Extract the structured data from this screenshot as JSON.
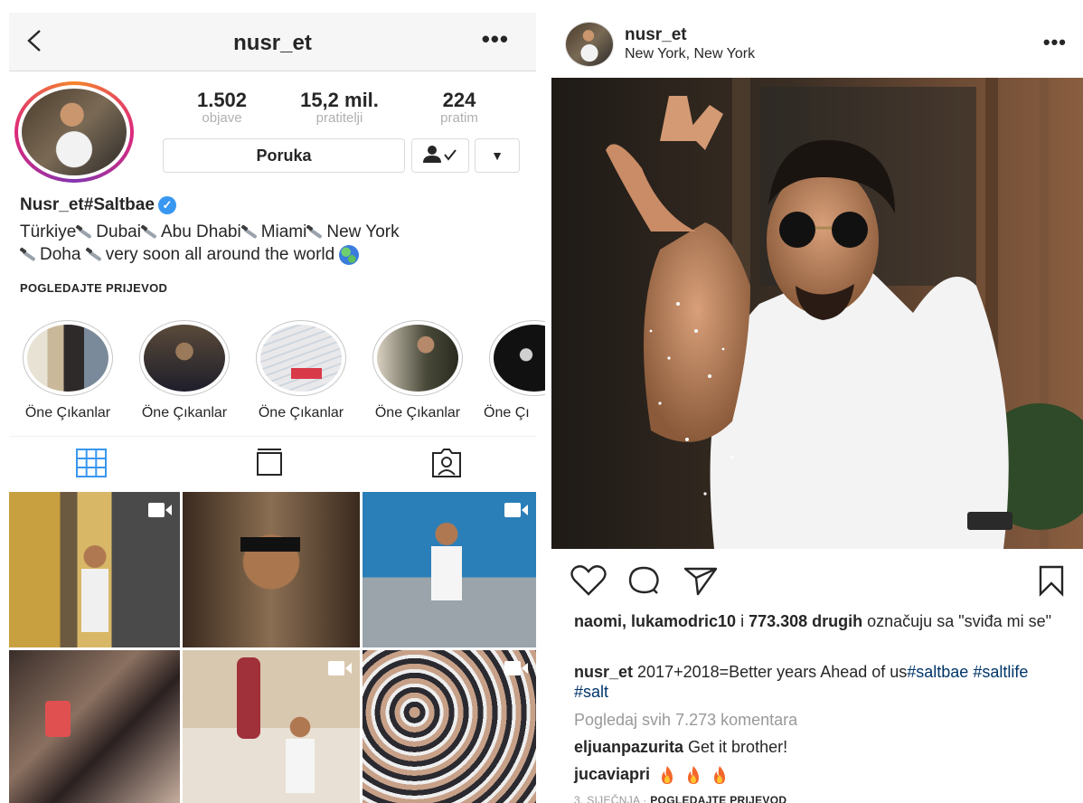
{
  "profile": {
    "header_username": "nusr_et",
    "stats": [
      {
        "value": "1.502",
        "label": "objave"
      },
      {
        "value": "15,2 mil.",
        "label": "pratitelji"
      },
      {
        "value": "224",
        "label": "pratim"
      }
    ],
    "message_button": "Poruka",
    "display_name": "Nusr_et#Saltbae",
    "bio": {
      "places": [
        "Türkiye",
        "Dubai",
        "Abu Dhabi",
        "Miami",
        "New York",
        "Doha"
      ],
      "tail": "very soon all around the world"
    },
    "translate": "POGLEDAJTE PRIJEVOD",
    "highlights": [
      "Öne Çıkanlar",
      "Öne Çıkanlar",
      "Öne Çıkanlar",
      "Öne Çıkanlar",
      "Öne Çı"
    ]
  },
  "post": {
    "username": "nusr_et",
    "location": "New York, New York",
    "likes": {
      "users": "naomi, lukamodric10",
      "connector": " i ",
      "count": "773.308 drugih",
      "suffix": " označuju sa \"sviđa mi se\""
    },
    "caption": {
      "user": "nusr_et",
      "text": " 2017+2018=Better years Ahead of us",
      "tags": "#saltbae #saltlife #salt"
    },
    "view_all": "Pogledaj svih 7.273 komentara",
    "comments": [
      {
        "user": "eljuanpazurita",
        "text": " Get it brother!"
      },
      {
        "user": "jucaviapri",
        "text": ""
      }
    ],
    "date": "3. SIJEČNJA",
    "translate": "POGLEDAJTE PRIJEVOD"
  },
  "colors": {
    "link_blue": "#003569",
    "verified_blue": "#3897f0",
    "muted": "#999999",
    "tab_active": "#3897f0"
  },
  "icons": [
    "back-icon",
    "more-icon",
    "verified-icon",
    "grid-icon",
    "feed-icon",
    "tagged-icon",
    "video-icon",
    "heart-icon",
    "comment-icon",
    "share-icon",
    "bookmark-icon",
    "fire-icon",
    "knife-icon",
    "globe-icon"
  ]
}
